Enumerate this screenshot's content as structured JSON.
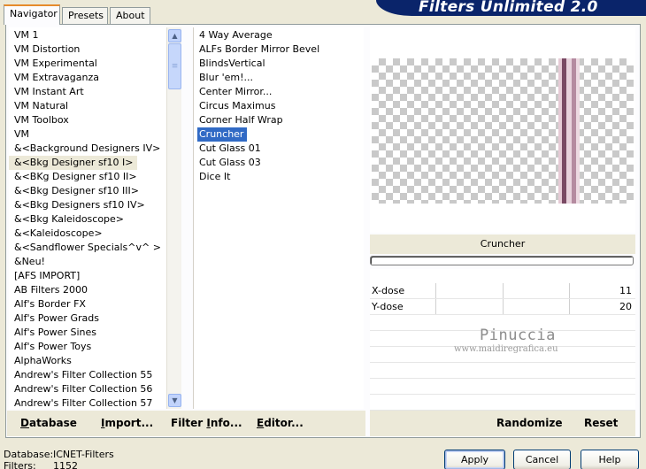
{
  "app": {
    "title": "Filters Unlimited 2.0",
    "tabs": [
      {
        "label": "Navigator",
        "active": true
      },
      {
        "label": "Presets",
        "active": false
      },
      {
        "label": "About",
        "active": false
      }
    ]
  },
  "categories": {
    "items": [
      "VM 1",
      "VM Distortion",
      "VM Experimental",
      "VM Extravaganza",
      "VM Instant Art",
      "VM Natural",
      "VM Toolbox",
      "VM",
      "&<Background Designers IV>",
      "&<Bkg Designer sf10 I>",
      "&<BKg Designer sf10 II>",
      "&<Bkg Designer sf10 III>",
      "&<Bkg Designers sf10 IV>",
      "&<Bkg Kaleidoscope>",
      "&<Kaleidoscope>",
      "&<Sandflower Specials^v^ >",
      "&Neu!",
      "[AFS IMPORT]",
      "AB Filters 2000",
      "Alf's Border FX",
      "Alf's Power Grads",
      "Alf's Power Sines",
      "Alf's Power Toys",
      "AlphaWorks",
      "Andrew's Filter Collection 55",
      "Andrew's Filter Collection 56",
      "Andrew's Filter Collection 57"
    ],
    "selected": "&<Bkg Designer sf10 I>"
  },
  "filters": {
    "items": [
      "4 Way Average",
      "ALFs Border Mirror Bevel",
      "BlindsVertical",
      "Blur 'em!...",
      "Center Mirror...",
      "Circus Maximus",
      "Corner Half Wrap",
      "Cruncher",
      "Cut Glass 01",
      "Cut Glass 03",
      "Dice It"
    ],
    "selected": "Cruncher"
  },
  "preview": {
    "filter_name": "Cruncher"
  },
  "params": [
    {
      "label": "X-dose",
      "value": "11"
    },
    {
      "label": "Y-dose",
      "value": "20"
    }
  ],
  "watermark": {
    "line1": "Pinuccia",
    "line2": "www.maidiregrafica.eu"
  },
  "links": {
    "database": {
      "pre": "",
      "ul": "D",
      "post": "atabase"
    },
    "import": {
      "pre": "",
      "ul": "I",
      "post": "mport..."
    },
    "filter_info": {
      "pre": "Filter ",
      "ul": "I",
      "post": "nfo..."
    },
    "editor": {
      "pre": "",
      "ul": "E",
      "post": "ditor..."
    },
    "randomize": {
      "pre": "Randomize",
      "ul": "",
      "post": ""
    },
    "reset": {
      "pre": "Reset",
      "ul": "",
      "post": ""
    }
  },
  "status": {
    "database_label": "Database:",
    "database_value": "ICNET-Filters",
    "filters_label": "Filters:",
    "filters_value": "1152"
  },
  "buttons": {
    "apply": "Apply",
    "cancel": "Cancel",
    "help": "Help"
  },
  "colors": {
    "selection_blue": "#316ac5",
    "banner_navy": "#0a246a",
    "tab_highlight": "#e68b2c"
  }
}
